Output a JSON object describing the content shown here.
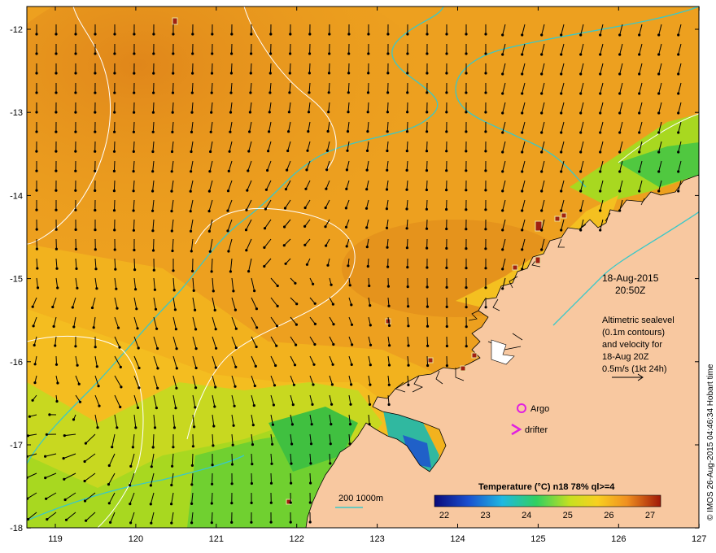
{
  "map": {
    "x_ticks": [
      "119",
      "120",
      "121",
      "122",
      "123",
      "124",
      "125",
      "126",
      "127"
    ],
    "y_ticks": [
      "-12",
      "-13",
      "-14",
      "-15",
      "-16",
      "-17",
      "-18"
    ],
    "date": "18-Aug-2015",
    "time": "20:50Z",
    "info_lines": [
      "Altimetric sealevel",
      "(0.1m contours)",
      "and velocity for",
      "18-Aug 20Z",
      "0.5m/s (1kt 24h)"
    ],
    "argo_label": "Argo",
    "drifter_label": "drifter",
    "depth_legend": "200  1000m",
    "colorbar_title": "Temperature (°C) n18 78% ql>=4",
    "colorbar_ticks": [
      "22",
      "23",
      "24",
      "25",
      "26",
      "27"
    ],
    "credit": "© IMOS 26-Aug-2015 04:46:34 Hobart time",
    "colors": {
      "ocean_warm": "#e89a1e",
      "ocean_mid": "#f4b81e",
      "ocean_cool": "#a8d820",
      "land": "#f8c8a0",
      "bathymetry": "#3ac8c8",
      "contour": "#ffffff",
      "argo": "#e020e0",
      "drifter": "#e020e0"
    }
  }
}
